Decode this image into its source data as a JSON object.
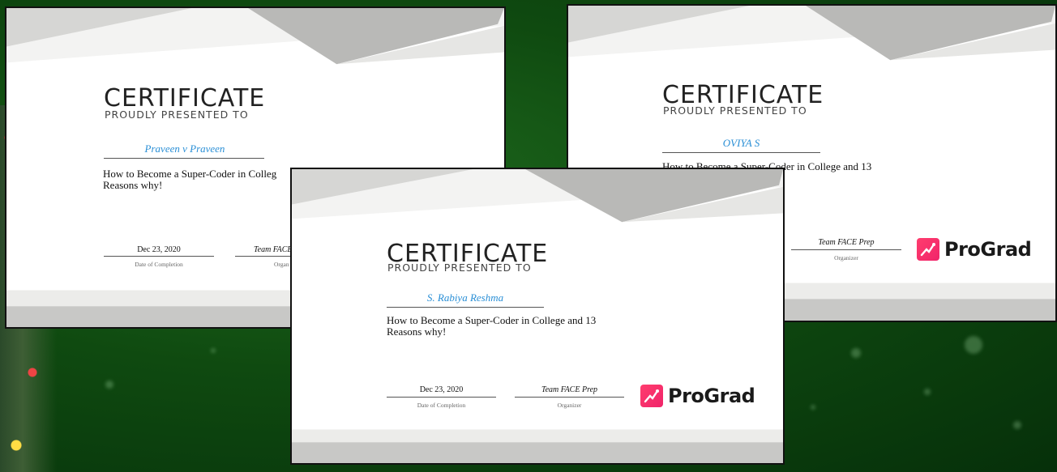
{
  "certificates": [
    {
      "title": "CERTIFICATE",
      "subtitle": "PROUDLY PRESENTED TO",
      "recipient": "Praveen v Praveen",
      "course_line1": "How to Become a Super-Coder in Colleg",
      "course_line2": "Reasons why!",
      "date": "Dec 23, 2020",
      "date_caption": "Date of Completion",
      "organizer": "Team FACE",
      "organizer_caption": "Organ"
    },
    {
      "title": "CERTIFICATE",
      "subtitle": "PROUDLY PRESENTED TO",
      "recipient": "OVIYA S",
      "course_line1": "How to Become a Super-Coder in College  and 13",
      "organizer": "Team FACE Prep",
      "organizer_caption": "Organizer",
      "logo_text": "ProGrad"
    },
    {
      "title": "CERTIFICATE",
      "subtitle": "PROUDLY PRESENTED TO",
      "recipient": "S. Rabiya Reshma",
      "course_line1": "How to Become a Super-Coder in College  and 13",
      "course_line2": "Reasons why!",
      "date": "Dec 23, 2020",
      "date_caption": "Date of Completion",
      "organizer": "Team FACE Prep",
      "organizer_caption": "Organizer",
      "logo_text": "ProGrad"
    }
  ],
  "colors": {
    "background": "#0f4a10",
    "recipient_name": "#2a8fd6",
    "logo_mark": "#f0246a"
  },
  "icons": [
    "prograd-logo-icon"
  ]
}
